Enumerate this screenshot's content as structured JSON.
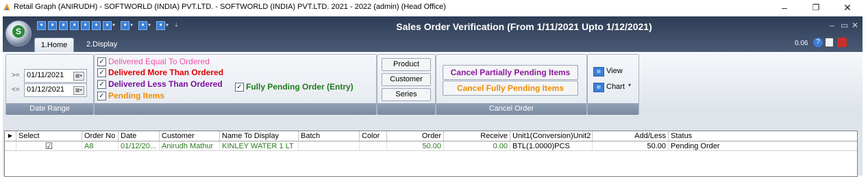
{
  "os_window": {
    "title": "Retail Graph (ANIRUDH) - SOFTWORLD (INDIA) PVT.LTD. - SOFTWORLD (INDIA) PVT.LTD.  2021 - 2022 (admin) (Head Office)",
    "minimize": "–",
    "maximize": "❐",
    "close": "✕"
  },
  "app": {
    "title": "Sales Order Verification (From 1/11/2021 Upto 1/12/2021)",
    "version": "0.06",
    "logo_letter": "S",
    "tabs": [
      "1.Home",
      "2.Display"
    ],
    "window_controls": {
      "minimize": "–",
      "restore": "▭",
      "close": "✕"
    }
  },
  "date_range": {
    "group_label": "Date Range",
    "from_prefix": ">=",
    "from_value": "01/11/2021",
    "to_prefix": "<=",
    "to_value": "01/12/2021"
  },
  "filters": {
    "items": [
      {
        "label": "Delivered Equal To Ordered",
        "checked": true,
        "color": "#f04fa8"
      },
      {
        "label": "Delivered More Than Ordered",
        "checked": true,
        "color": "#e00000"
      },
      {
        "label": "Delivered Less Than Ordered",
        "checked": true,
        "color": "#7a0ea0"
      },
      {
        "label": "Pending Items",
        "checked": true,
        "color": "#f08c00"
      }
    ],
    "fully_pending": {
      "label": "Fully Pending Order (Entry)",
      "checked": true,
      "color": "#1e7a1e"
    }
  },
  "options": {
    "buttons": [
      "Product",
      "Customer",
      "Series"
    ]
  },
  "cancel_order": {
    "group_label": "Cancel Order",
    "partial_label": "Cancel Partially Pending Items",
    "partial_color": "#8a1a9a",
    "full_label": "Cancel Fully Pending Items",
    "full_color": "#f08c00"
  },
  "view_group": {
    "view_label": "View",
    "chart_label": "Chart"
  },
  "grid": {
    "columns": [
      "Select",
      "Order No",
      "Date",
      "Customer",
      "Name To Display",
      "Batch",
      "Color",
      "Order",
      "Receive",
      "Unit1(Conversion)Unit2",
      "Add/Less",
      "Status"
    ],
    "rows": [
      {
        "select": "☑",
        "order_no": "A8",
        "date": "01/12/20...",
        "customer": "Anirudh Mathur",
        "name_to_display": "KINLEY WATER 1 LT",
        "batch": "",
        "color": "",
        "order": "50.00",
        "receive": "0.00",
        "unit": "BTL(1.0000)PCS",
        "add_less": "50.00",
        "status": "Pending Order"
      }
    ]
  }
}
